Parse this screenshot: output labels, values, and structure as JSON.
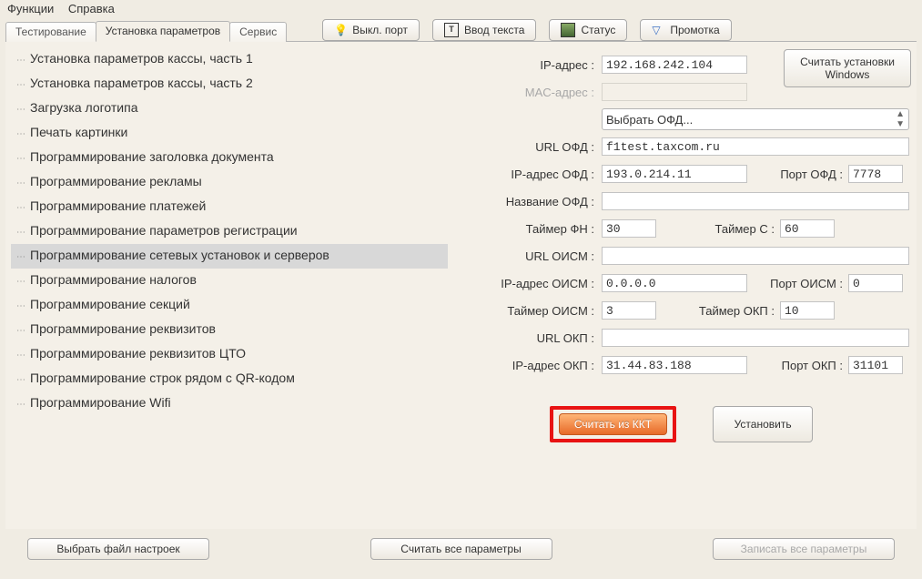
{
  "menu": {
    "functions": "Функции",
    "help": "Справка"
  },
  "tabs": {
    "test": "Тестирование",
    "params": "Установка параметров",
    "service": "Сервис"
  },
  "toolbar": {
    "port_off": "Выкл. порт",
    "text_input": "Ввод текста",
    "status": "Статус",
    "rewind": "Промотка"
  },
  "tree": [
    "Установка параметров кассы, часть 1",
    "Установка параметров кассы, часть 2",
    "Загрузка логотипа",
    "Печать картинки",
    "Программирование заголовка документа",
    "Программирование рекламы",
    "Программирование платежей",
    "Программирование параметров регистрации",
    "Программирование сетевых установок и серверов",
    "Программирование налогов",
    "Программирование секций",
    "Программирование реквизитов",
    "Программирование реквизитов ЦТО",
    "Программирование строк рядом с QR-кодом",
    "Программирование Wifi"
  ],
  "tree_selected_index": 8,
  "labels": {
    "ip": "IP-адрес :",
    "mac": "MAC-адрес :",
    "ofd_url": "URL ОФД :",
    "ofd_ip": "IP-адрес ОФД :",
    "ofd_name": "Название ОФД :",
    "timer_fn": "Таймер ФН :",
    "timer_c": "Таймер С :",
    "oism_url": "URL ОИСМ :",
    "oism_ip": "IP-адрес ОИСМ :",
    "oism_port": "Порт ОИСМ :",
    "oism_timer": "Таймер ОИСМ :",
    "okp_timer": "Таймер ОКП :",
    "okp_url": "URL ОКП :",
    "okp_ip": "IP-адрес ОКП :",
    "okp_port": "Порт ОКП :",
    "ofd_port": "Порт ОФД :",
    "select_ofd": "Выбрать ОФД..."
  },
  "values": {
    "ip": "192.168.242.104",
    "mac": "",
    "ofd_url": "f1test.taxcom.ru",
    "ofd_ip": "193.0.214.11",
    "ofd_port": "7778",
    "ofd_name": "",
    "timer_fn": "30",
    "timer_c": "60",
    "oism_url": "",
    "oism_ip": "0.0.0.0",
    "oism_port": "0",
    "oism_timer": "3",
    "okp_timer": "10",
    "okp_url": "",
    "okp_ip": "31.44.83.188",
    "okp_port": "31101"
  },
  "buttons": {
    "read_win": "Считать установки\nWindows",
    "read_kkt": "Считать из ККТ",
    "set": "Установить",
    "choose_file": "Выбрать файл настроек",
    "read_all": "Считать все параметры",
    "write_all": "Записать все параметры"
  }
}
